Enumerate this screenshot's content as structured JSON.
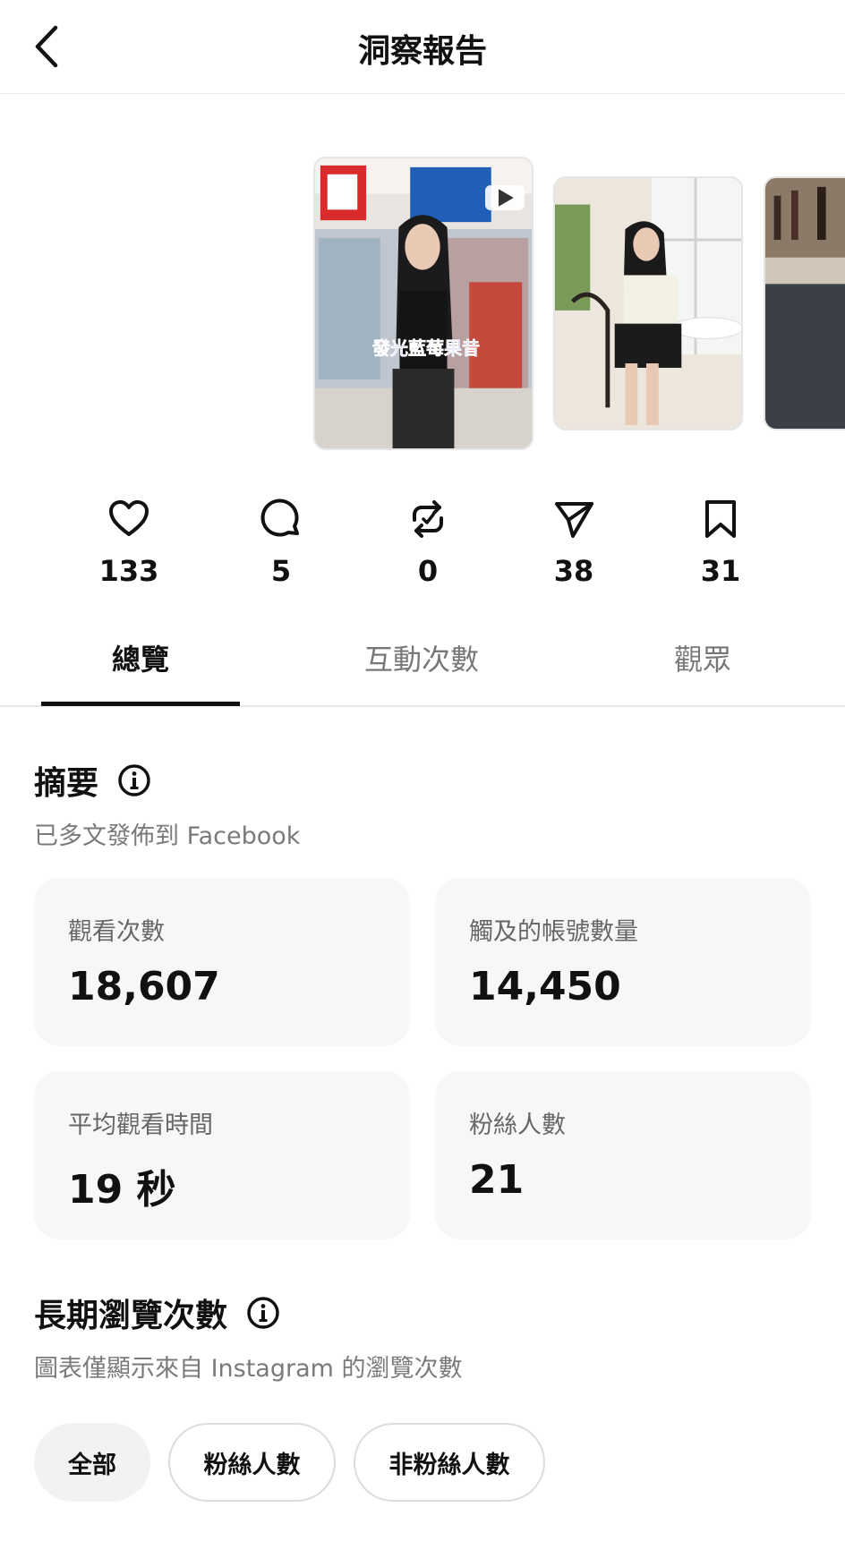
{
  "header": {
    "title": "洞察報告"
  },
  "thumbnails": {
    "caption": "發光藍莓果昔"
  },
  "stats": [
    {
      "icon": "heart-icon",
      "value": "133"
    },
    {
      "icon": "comment-icon",
      "value": "5"
    },
    {
      "icon": "repost-icon",
      "value": "0"
    },
    {
      "icon": "share-icon",
      "value": "38"
    },
    {
      "icon": "bookmark-icon",
      "value": "31"
    }
  ],
  "tabs": [
    {
      "label": "總覽",
      "active": true
    },
    {
      "label": "互動次數",
      "active": false
    },
    {
      "label": "觀眾",
      "active": false
    }
  ],
  "summary": {
    "title": "摘要",
    "subtitle": "已多文發佈到 Facebook",
    "cards": [
      {
        "label": "觀看次數",
        "value": "18,607"
      },
      {
        "label": "觸及的帳號數量",
        "value": "14,450"
      },
      {
        "label": "平均觀看時間",
        "value": "19 秒"
      },
      {
        "label": "粉絲人數",
        "value": "21"
      }
    ]
  },
  "longterm": {
    "title": "長期瀏覽次數",
    "subtitle": "圖表僅顯示來自 Instagram 的瀏覽次數",
    "filters": [
      {
        "label": "全部",
        "selected": true
      },
      {
        "label": "粉絲人數",
        "selected": false
      },
      {
        "label": "非粉絲人數",
        "selected": false
      }
    ]
  }
}
